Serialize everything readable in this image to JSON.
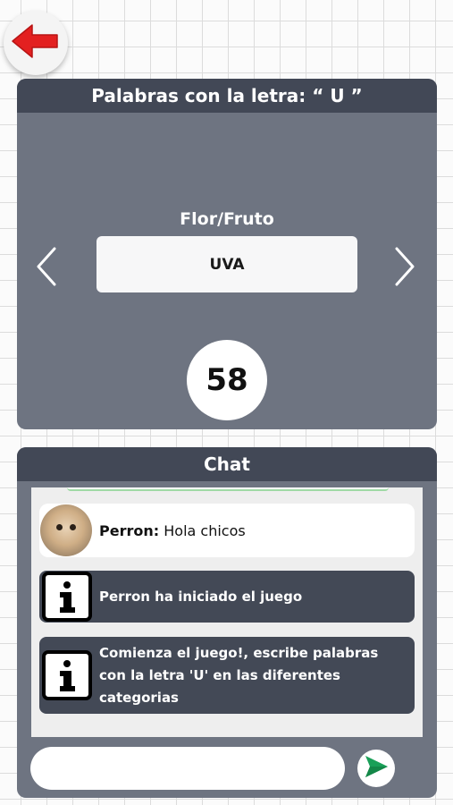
{
  "back_button": {
    "icon": "arrow-left-icon",
    "color": "#e32020"
  },
  "game": {
    "title": "Palabras con la letra: “ U ”",
    "category": "Flor/Fruto",
    "word": "UVA",
    "timer": "58",
    "prev_icon": "chevron-left-icon",
    "next_icon": "chevron-right-icon"
  },
  "chat": {
    "title": "Chat",
    "messages": [
      {
        "type": "user",
        "author": "Perron",
        "separator": ":",
        "text": "Hola chicos",
        "avatar_icon": "dog-avatar"
      },
      {
        "type": "system",
        "icon": "info-icon",
        "text": "Perron ha iniciado el juego"
      },
      {
        "type": "system",
        "icon": "info-icon",
        "text_lines": [
          "Comienza el juego!, escribe palabras",
          "con la letra 'U' en las diferentes",
          "categorias"
        ]
      }
    ],
    "input": {
      "value": "",
      "placeholder": ""
    },
    "send_icon": "send-icon",
    "send_color": "#1aa058"
  },
  "colors": {
    "panel_bg": "#6e7481",
    "header_bg": "#424856",
    "system_msg_bg": "#434956"
  }
}
